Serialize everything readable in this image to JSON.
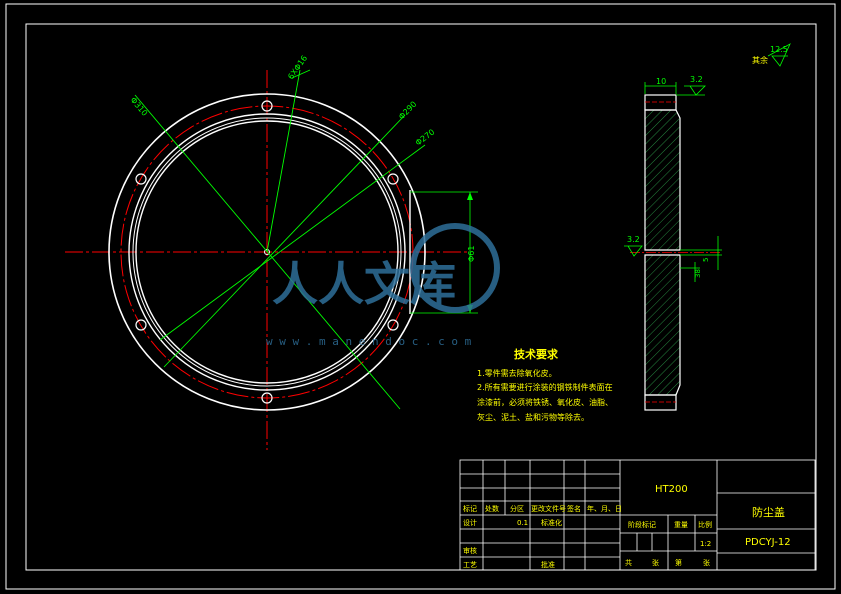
{
  "drawing": {
    "material": "HT200",
    "part_name": "防尘盖",
    "drawing_number": "PDCYJ-12",
    "scale": "1:2",
    "watermark_url": "w w w . m a n e n d o c . c o m"
  },
  "front_view_dims": {
    "d_outer": "Φ310",
    "d_pcd": "6XΦ16",
    "d_inner1": "Φ290",
    "d_inner2": "Φ270"
  },
  "side_view_dims": {
    "thickness": "10",
    "roughness_top": "3.2",
    "roughness_mid": "3.2",
    "height": "Φ61",
    "step_a": "5",
    "step_b": "38"
  },
  "roughness_other": {
    "label": "其余",
    "value": "12.5"
  },
  "tech_requirements": {
    "title": "技术要求",
    "lines": [
      "1.零件需去除氧化皮。",
      "2.所有需要进行涂装的钢铁制件表面在",
      "涂漆前，必须将铁锈、氧化皮、油脂、",
      "灰尘、泥土、盐和污物等除去。"
    ]
  },
  "title_block": {
    "rev_headers": [
      "标记",
      "处数",
      "分区",
      "更改文件号",
      "签名",
      "年、月、日"
    ],
    "design": "设计",
    "design_val": "0.1",
    "standardize": "标准化",
    "stage_mark": "阶段标记",
    "weight": "重量",
    "scale_label": "比例",
    "review": "审核",
    "process": "工艺",
    "approve": "批准",
    "sheet_total": "共",
    "sheet_unit1": "张",
    "sheet_no": "第",
    "sheet_unit2": "张"
  },
  "colors": {
    "white": "#ffffff",
    "green": "#00ff00",
    "red": "#ff0000",
    "yellow": "#ffff00",
    "watermark": "#2e6f99"
  }
}
